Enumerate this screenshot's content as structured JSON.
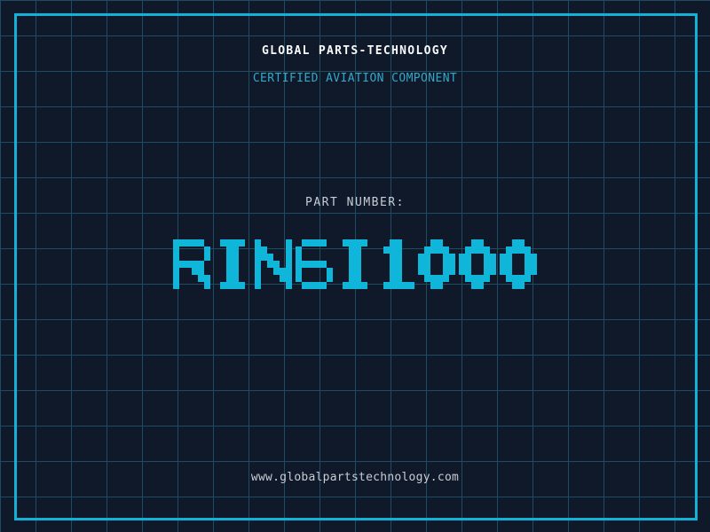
{
  "colors": {
    "background": "#0f1929",
    "grid_line": "#1d4d61",
    "frame": "#12b1d5",
    "part_number": "#0fb6da",
    "certification_text": "#35a7c9",
    "title_text": "#f8fafb",
    "muted_text": "#c8cdd4"
  },
  "header": {
    "company": "GLOBAL PARTS-TECHNOLOGY",
    "certification": "CERTIFIED AVIATION COMPONENT"
  },
  "part": {
    "label": "PART NUMBER:",
    "value": "RIN6I1000"
  },
  "footer": {
    "website": "www.globalpartstechnology.com"
  }
}
